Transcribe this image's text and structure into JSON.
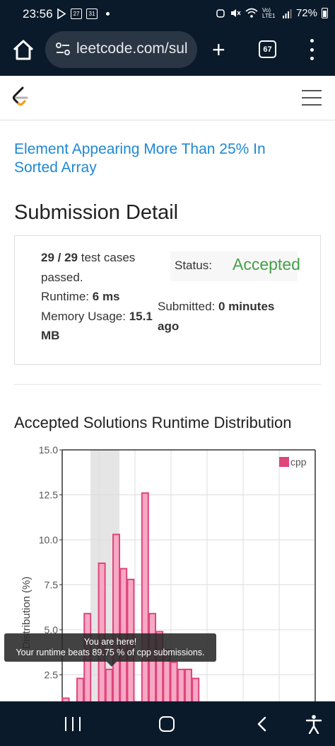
{
  "status_bar": {
    "time": "23:56",
    "calendar_1": "27",
    "calendar_2": "31",
    "network": "Vo) LTE1",
    "battery": "72%"
  },
  "browser": {
    "url": "leetcode.com/sul",
    "tab_count": "67"
  },
  "problem": {
    "title": "Element Appearing More Than 25% In Sorted Array"
  },
  "page": {
    "title": "Submission Detail"
  },
  "submission": {
    "test_cases": "29 / 29",
    "test_cases_suffix": "test cases passed.",
    "runtime_label": "Runtime:",
    "runtime_value": "6 ms",
    "memory_label": "Memory Usage:",
    "memory_value": "15.1 MB",
    "status_label": "Status:",
    "status_value": "Accepted",
    "submitted_label": "Submitted:",
    "submitted_value": "0 minutes ago"
  },
  "chart_section": {
    "title": "Accepted Solutions Runtime Distribution"
  },
  "tooltip": {
    "line1": "You are here!",
    "line2": "Your runtime beats 89.75 % of cpp submissions."
  },
  "colors": {
    "accent_link": "#1e88d4",
    "accepted": "#43a047",
    "bar_fill": "#f7a8c4",
    "bar_stroke": "#e0457b",
    "highlight": "#e5e5e5"
  },
  "chart_data": {
    "type": "bar",
    "ylabel": "Distribution (%)",
    "ylim": [
      0,
      15
    ],
    "yticks": [
      "15.0",
      "12.5",
      "10.0",
      "7.5",
      "5.0",
      "2.5"
    ],
    "legend": "cpp",
    "legend_position": "top-right",
    "grid": true,
    "highlighted_bin": 3,
    "series": [
      {
        "name": "cpp",
        "values": [
          1.2,
          0,
          2.3,
          5.9,
          0,
          8.7,
          2.8,
          10.3,
          8.4,
          7.8,
          1.0,
          12.6,
          5.9,
          4.9,
          3.9,
          3.2,
          2.8,
          2.8,
          2.3
        ]
      }
    ]
  }
}
